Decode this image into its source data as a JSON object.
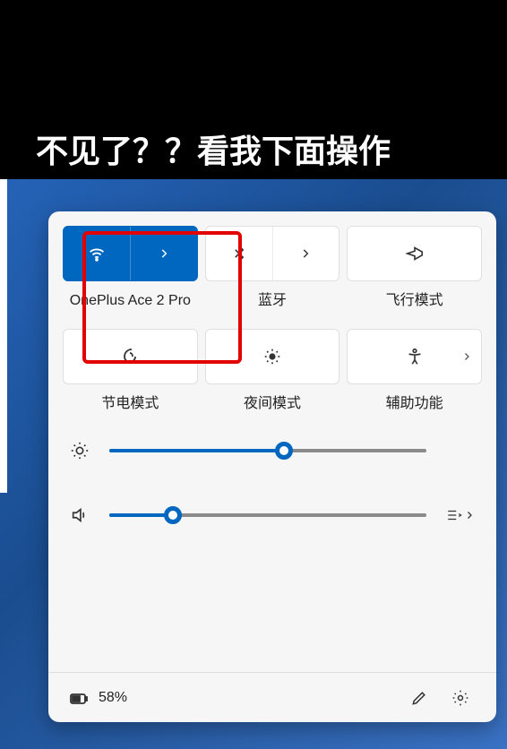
{
  "caption": "不见了？？看我下面操作",
  "tiles_row1": {
    "wifi": {
      "label": "OnePlus Ace 2 Pro",
      "active": true
    },
    "bluetooth": {
      "label": "蓝牙"
    },
    "airplane": {
      "label": "飞行模式"
    }
  },
  "tiles_row2": {
    "battery_saver": {
      "label": "节电模式"
    },
    "night_mode": {
      "label": "夜间模式"
    },
    "accessibility": {
      "label": "辅助功能"
    }
  },
  "sliders": {
    "brightness": 55,
    "volume": 20
  },
  "bottom": {
    "battery_percent": "58%"
  },
  "colors": {
    "accent": "#0067c0",
    "highlight": "#e30000"
  }
}
